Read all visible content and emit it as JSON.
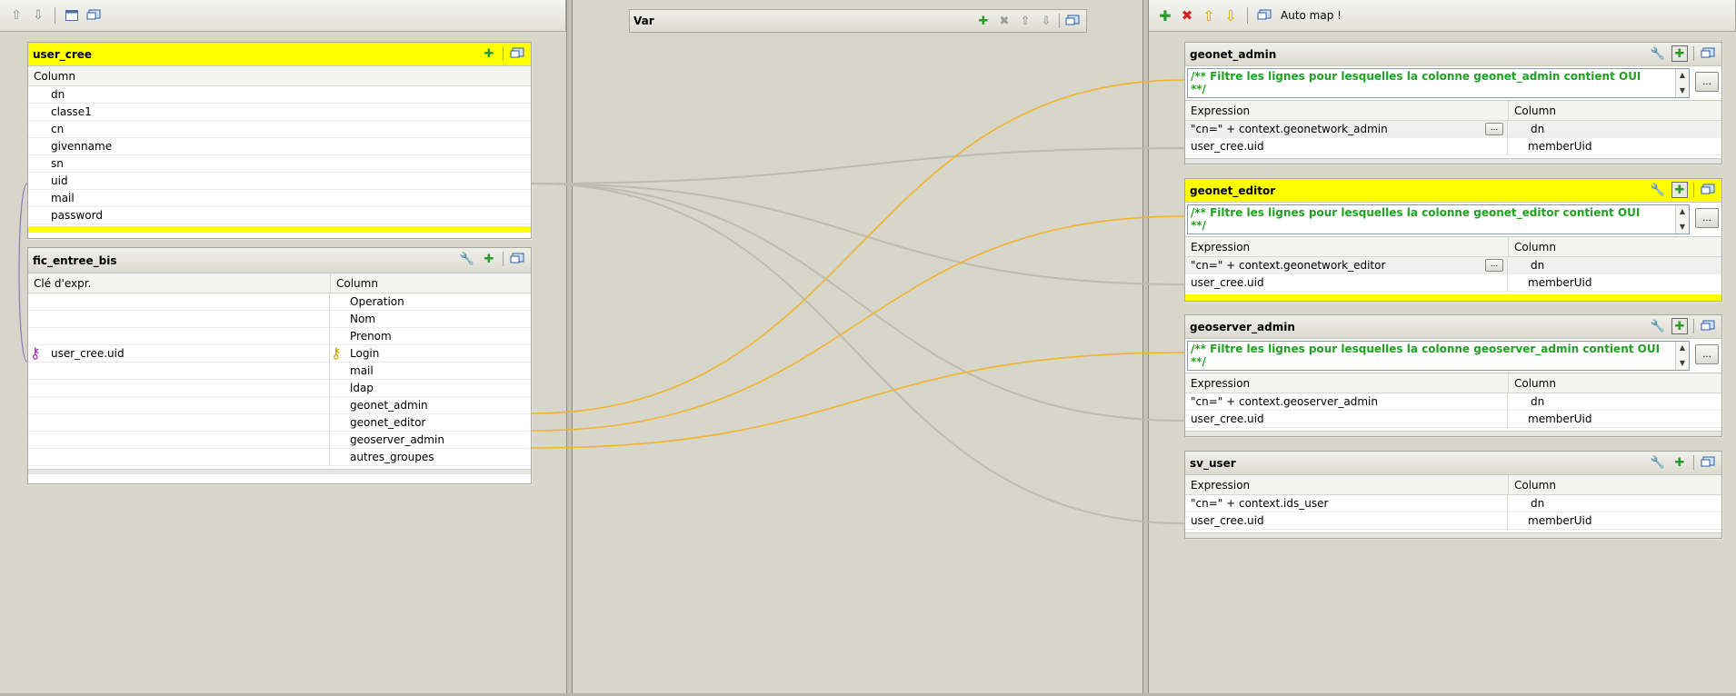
{
  "toolbars": {
    "left": {
      "icons": [
        "arrow-up-icon",
        "arrow-down-icon",
        "window-icon",
        "monitor-icon"
      ]
    },
    "right": {
      "auto_map_label": "Auto map !"
    }
  },
  "input_tables": [
    {
      "name": "user_cree",
      "column_header": "Column",
      "columns": [
        "dn",
        "classe1",
        "cn",
        "givenname",
        "sn",
        "uid",
        "mail",
        "password"
      ]
    },
    {
      "name": "fic_entree_bis",
      "key_header": "Clé d'expr.",
      "column_header": "Column",
      "rows": [
        {
          "key": "",
          "column": "Operation"
        },
        {
          "key": "",
          "column": "Nom"
        },
        {
          "key": "",
          "column": "Prenom"
        },
        {
          "key": "user_cree.uid",
          "column": "Login"
        },
        {
          "key": "",
          "column": "mail"
        },
        {
          "key": "",
          "column": "ldap"
        },
        {
          "key": "",
          "column": "geonet_admin"
        },
        {
          "key": "",
          "column": "geonet_editor"
        },
        {
          "key": "",
          "column": "geoserver_admin"
        },
        {
          "key": "",
          "column": "autres_groupes"
        }
      ]
    }
  ],
  "var_table": {
    "name": "Var"
  },
  "output_tables": [
    {
      "name": "geonet_admin",
      "filter_line1": "/** Filtre les lignes pour lesquelles la colonne geonet_admin contient OUI",
      "filter_line2": "**/",
      "expression_header": "Expression",
      "column_header": "Column",
      "rows": [
        {
          "expression": "\"cn=\" + context.geonetwork_admin",
          "column": "dn"
        },
        {
          "expression": "user_cree.uid",
          "column": "memberUid"
        }
      ]
    },
    {
      "name": "geonet_editor",
      "filter_line1": "/** Filtre les lignes pour lesquelles la colonne geonet_editor contient OUI",
      "filter_line2": "**/",
      "expression_header": "Expression",
      "column_header": "Column",
      "rows": [
        {
          "expression": "\"cn=\" + context.geonetwork_editor",
          "column": "dn"
        },
        {
          "expression": "user_cree.uid",
          "column": "memberUid"
        }
      ]
    },
    {
      "name": "geoserver_admin",
      "filter_line1": "/** Filtre les lignes pour lesquelles la colonne geoserver_admin contient OUI",
      "filter_line2": "**/",
      "expression_header": "Expression",
      "column_header": "Column",
      "rows": [
        {
          "expression": "\"cn=\" + context.geoserver_admin",
          "column": "dn"
        },
        {
          "expression": "user_cree.uid",
          "column": "memberUid"
        }
      ]
    },
    {
      "name": "sv_user",
      "expression_header": "Expression",
      "column_header": "Column",
      "rows": [
        {
          "expression": "\"cn=\" + context.ids_user",
          "column": "dn"
        },
        {
          "expression": "user_cree.uid",
          "column": "memberUid"
        }
      ]
    }
  ],
  "filter_button_label": "...",
  "expr_button_label": "...",
  "colors": {
    "active_header": "#ffff00",
    "filter_text": "#21a021",
    "link_orange": "#f5b22a",
    "link_gray": "#bdbcae",
    "key_purple": "#9a2fb0",
    "key_gold": "#c9a400"
  }
}
